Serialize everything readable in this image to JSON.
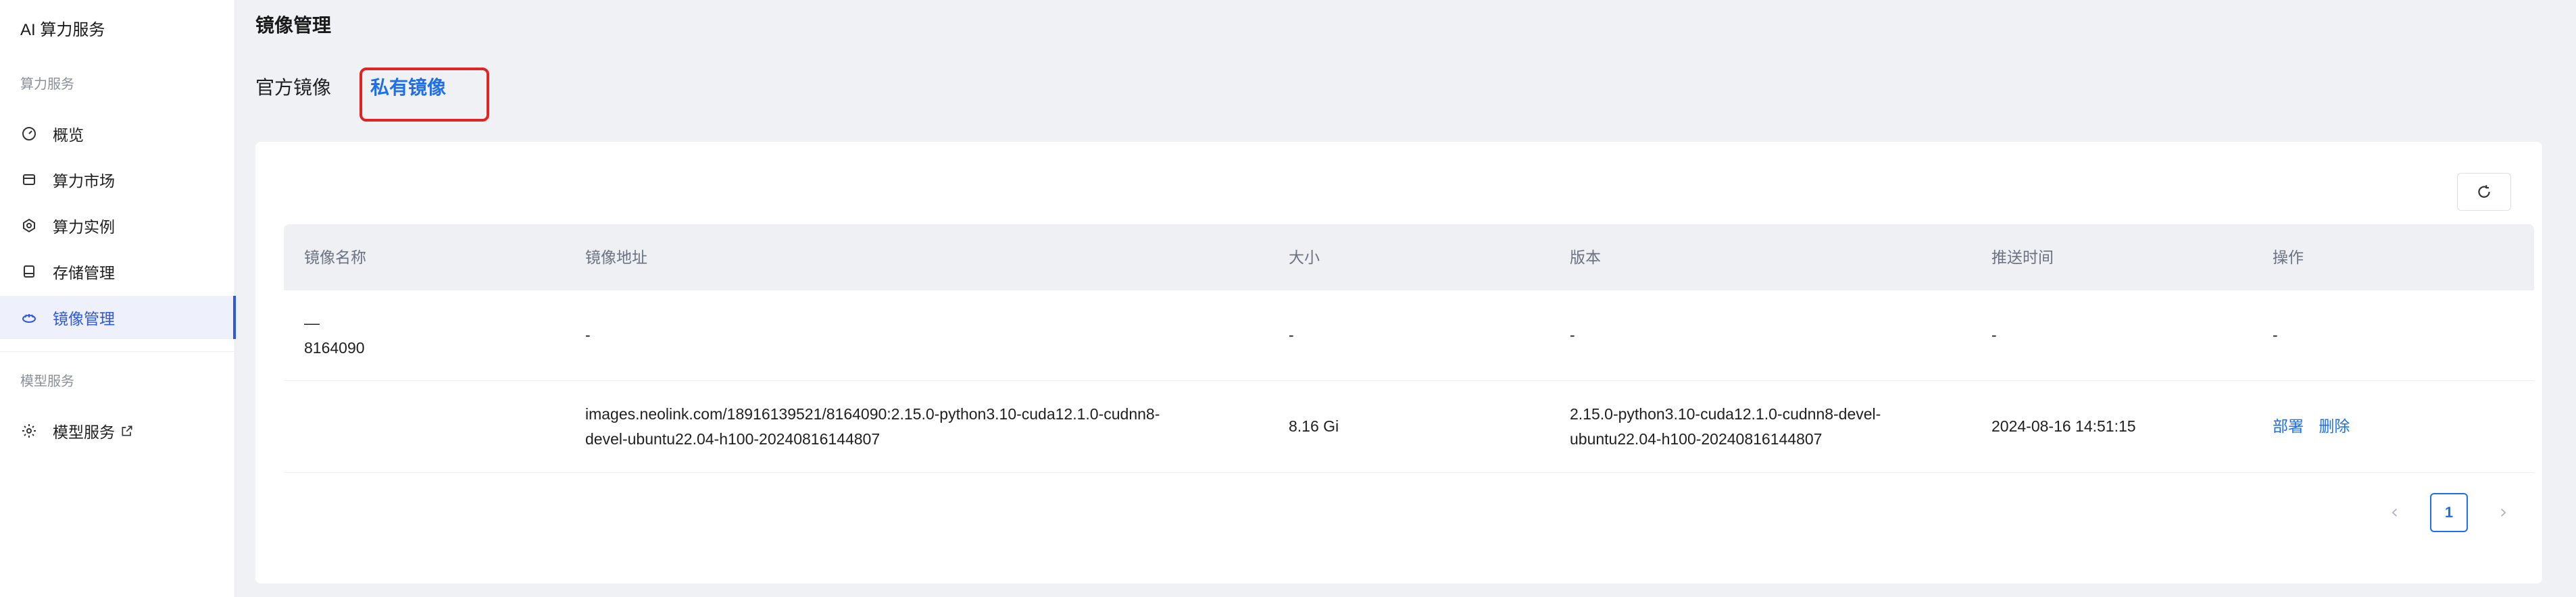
{
  "sidebar": {
    "brand": "AI 算力服务",
    "section1": "算力服务",
    "items": [
      {
        "label": "概览",
        "icon": "dashboard-icon"
      },
      {
        "label": "算力市场",
        "icon": "store-icon"
      },
      {
        "label": "算力实例",
        "icon": "instance-icon"
      },
      {
        "label": "存储管理",
        "icon": "storage-icon"
      },
      {
        "label": "镜像管理",
        "icon": "image-icon",
        "active": true
      }
    ],
    "section2": "模型服务",
    "model_item": {
      "label": "模型服务",
      "icon": "gear-icon",
      "external_icon": "external-link-icon"
    }
  },
  "page": {
    "title": "镜像管理",
    "tabs": [
      {
        "label": "官方镜像"
      },
      {
        "label": "私有镜像",
        "active": true
      }
    ]
  },
  "table": {
    "headers": [
      "镜像名称",
      "镜像地址",
      "大小",
      "版本",
      "推送时间",
      "操作"
    ],
    "rows": [
      {
        "name_line1": "—",
        "name_line2": "8164090",
        "address": "-",
        "size": "-",
        "version": "-",
        "pushed": "-",
        "ops": "-"
      },
      {
        "name": "",
        "address_line1": "images.neolink.com/18916139521/8164090:2.15.0-python3.10-cuda12.1.0-cudnn8-",
        "address_line2": "devel-ubuntu22.04-h100-20240816144807",
        "size": "8.16 Gi",
        "version_line1": "2.15.0-python3.10-cuda12.1.0-cudnn8-devel-",
        "version_line2": "ubuntu22.04-h100-20240816144807",
        "pushed": "2024-08-16 14:51:15",
        "deploy": "部署",
        "delete": "删除"
      }
    ]
  },
  "pagination": {
    "current": "1"
  },
  "colors": {
    "accent": "#1f6feb",
    "highlight": "#e02424"
  }
}
